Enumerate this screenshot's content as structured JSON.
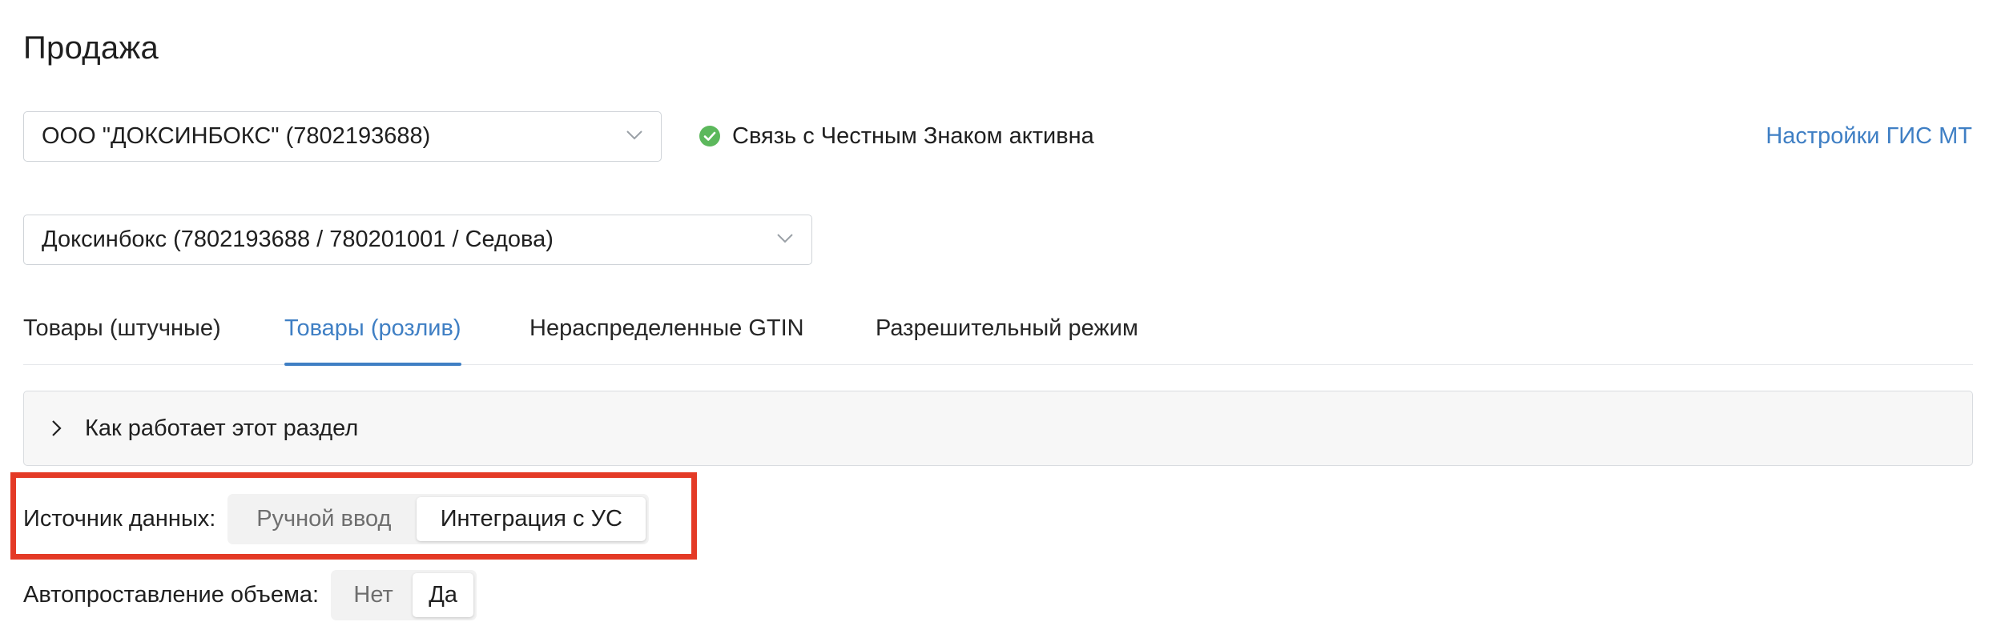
{
  "page": {
    "title": "Продажа"
  },
  "org_select": {
    "value": "ООО \"ДОКСИНБОКС\" (7802193688)"
  },
  "status": {
    "text": "Связь с Честным Знаком активна",
    "icon": "check-circle-icon",
    "color": "#5cb85c"
  },
  "settings_link": {
    "label": "Настройки ГИС МТ"
  },
  "branch_select": {
    "value": "Доксинбокс (7802193688 / 780201001 / Седова)"
  },
  "tabs": [
    {
      "label": "Товары (штучные)",
      "active": false
    },
    {
      "label": "Товары (розлив)",
      "active": true
    },
    {
      "label": "Нераспределенные GTIN",
      "active": false
    },
    {
      "label": "Разрешительный режим",
      "active": false
    }
  ],
  "accordion": {
    "label": "Как работает этот раздел",
    "expanded": false
  },
  "data_source": {
    "label": "Источник данных:",
    "options": [
      "Ручной ввод",
      "Интеграция с УС"
    ],
    "selected": "Интеграция с УС",
    "highlighted": true
  },
  "auto_volume": {
    "label": "Автопроставление объема:",
    "options": [
      "Нет",
      "Да"
    ],
    "selected": "Да"
  },
  "colors": {
    "accent": "#3f7fc4",
    "highlight": "#e43a26",
    "success": "#5cb85c"
  }
}
